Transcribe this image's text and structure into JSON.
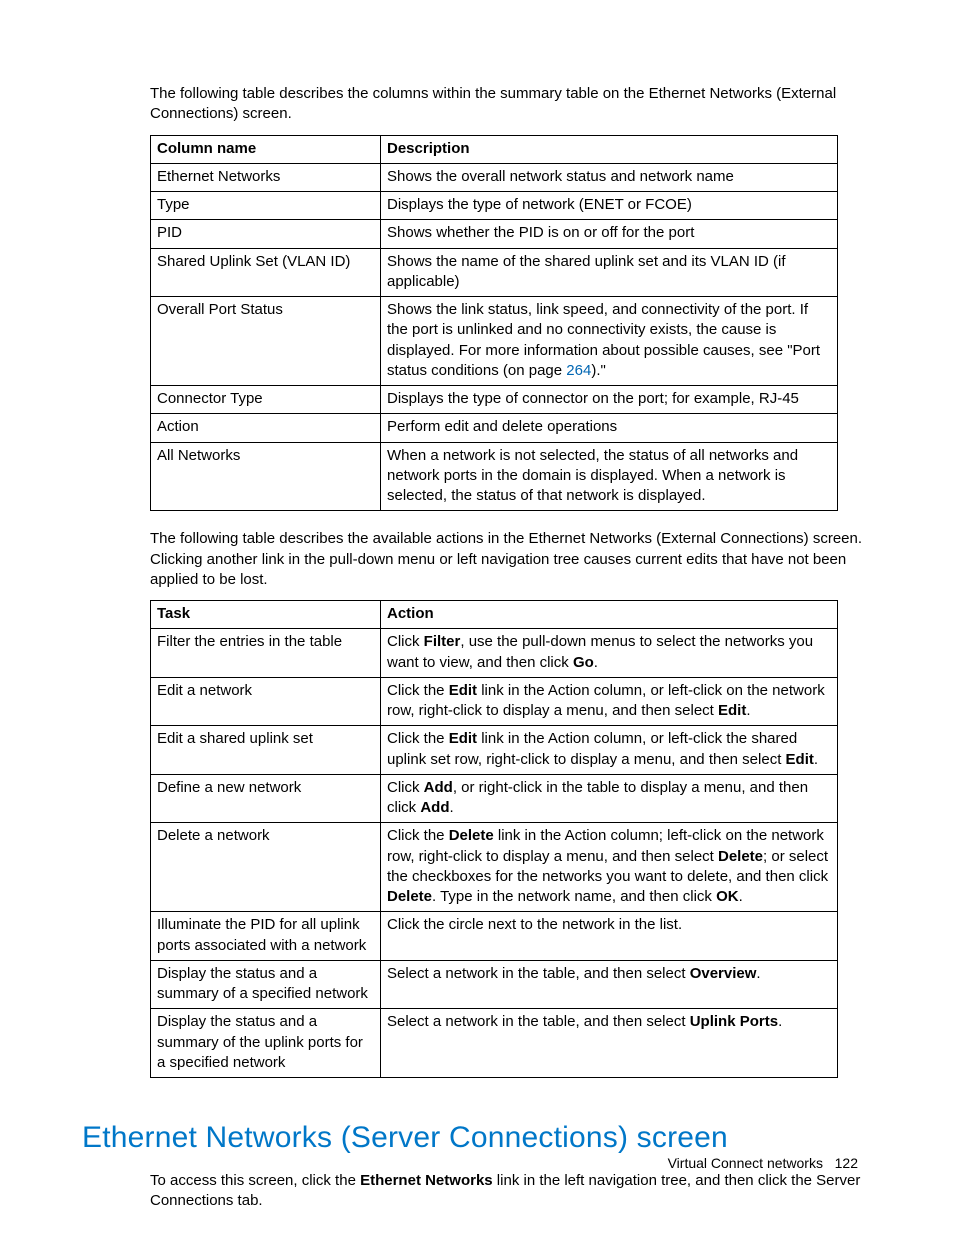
{
  "intro1": "The following table describes the columns within the summary table on the Ethernet Networks (External Connections) screen.",
  "table1": {
    "head": {
      "c1": "Column name",
      "c2": "Description"
    },
    "rows": [
      {
        "c1": "Ethernet Networks",
        "c2": "Shows the overall network status and network name"
      },
      {
        "c1": "Type",
        "c2": "Displays the type of network (ENET or FCOE)"
      },
      {
        "c1": "PID",
        "c2": "Shows whether the PID is on or off for the port"
      },
      {
        "c1": "Shared Uplink Set (VLAN ID)",
        "c2": "Shows the name of the shared uplink set and its VLAN ID (if applicable)"
      },
      {
        "c1": "Overall Port Status",
        "c2_pre": "Shows the link status, link speed, and connectivity of the port. If the port is unlinked and no connectivity exists, the cause is displayed. For more information about possible causes, see \"Port status conditions (on page ",
        "c2_link": "264",
        "c2_post": ").\""
      },
      {
        "c1": "Connector Type",
        "c2": "Displays the type of connector on the port; for example, RJ-45"
      },
      {
        "c1": "Action",
        "c2": "Perform edit and delete operations"
      },
      {
        "c1": "All Networks",
        "c2": "When a network is not selected, the status of all networks and network ports in the domain is displayed. When a network is selected, the status of that network is displayed."
      }
    ]
  },
  "intro2": "The following table describes the available actions in the Ethernet Networks (External Connections) screen. Clicking another link in the pull-down menu or left navigation tree causes current edits that have not been applied to be lost.",
  "table2": {
    "head": {
      "c1": "Task",
      "c2": "Action"
    },
    "rows": [
      {
        "c1": "Filter the entries in the table",
        "parts": [
          "Click ",
          "Filter",
          ", use the pull-down menus to select the networks you want to view, and then click ",
          "Go",
          "."
        ]
      },
      {
        "c1": "Edit a network",
        "parts": [
          "Click the ",
          "Edit",
          " link in the Action column, or left-click on the network row, right-click to display a menu, and then select ",
          "Edit",
          "."
        ]
      },
      {
        "c1": "Edit a shared uplink set",
        "parts": [
          "Click the ",
          "Edit",
          " link in the Action column, or left-click the shared uplink set row, right-click to display a menu, and then select ",
          "Edit",
          "."
        ]
      },
      {
        "c1": "Define a new network",
        "parts": [
          "Click ",
          "Add",
          ", or right-click in the table to display a menu, and then click ",
          "Add",
          "."
        ]
      },
      {
        "c1": "Delete a network",
        "parts": [
          "Click the ",
          "Delete",
          " link in the Action column; left-click on the network row, right-click to display a menu, and then select ",
          "Delete",
          "; or select the checkboxes for the networks you want to delete, and then click ",
          "Delete",
          ". Type in the network name, and then click ",
          "OK",
          "."
        ]
      },
      {
        "c1": "Illuminate the PID for all uplink ports associated with a network",
        "parts": [
          "Click the circle next to the network in the list."
        ]
      },
      {
        "c1": "Display the status and a summary of a specified network",
        "parts": [
          "Select a network in the table, and then select ",
          "Overview",
          "."
        ]
      },
      {
        "c1": "Display the status and a summary of the uplink ports for a specified network",
        "parts": [
          "Select a network in the table, and then select ",
          "Uplink Ports",
          "."
        ]
      }
    ]
  },
  "section_title": "Ethernet Networks (Server Connections) screen",
  "section_body_pre": "To access this screen, click the ",
  "section_body_bold": "Ethernet Networks",
  "section_body_post": " link in the left navigation tree, and then click the Server Connections tab.",
  "footer": {
    "label": "Virtual Connect networks",
    "page": "122"
  }
}
